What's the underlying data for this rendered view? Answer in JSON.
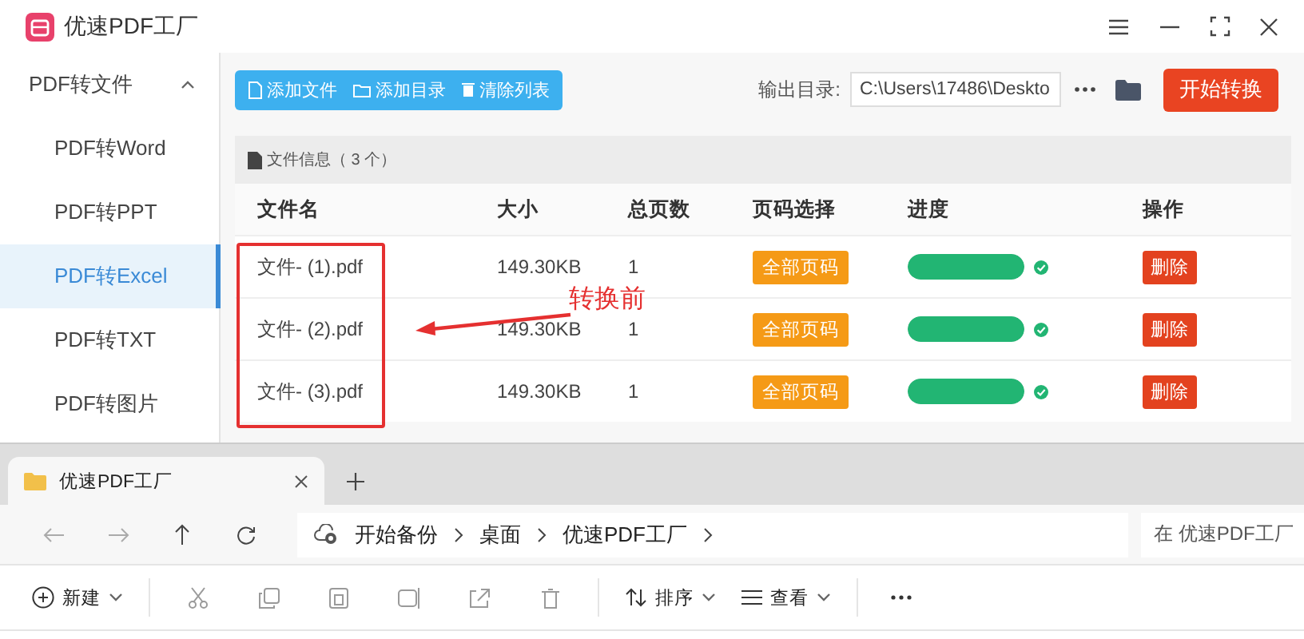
{
  "window": {
    "title": "优速PDF工厂"
  },
  "sidebar": {
    "items": [
      {
        "label": "PDF转文件",
        "kind": "group",
        "expanded": true,
        "selected": false
      },
      {
        "label": "PDF转Word",
        "kind": "item",
        "selected": false
      },
      {
        "label": "PDF转PPT",
        "kind": "item",
        "selected": false
      },
      {
        "label": "PDF转Excel",
        "kind": "item",
        "selected": true
      },
      {
        "label": "PDF转TXT",
        "kind": "item",
        "selected": false
      },
      {
        "label": "PDF转图片",
        "kind": "item",
        "selected": false
      }
    ]
  },
  "toolbar": {
    "buttons": [
      {
        "label": "添加文件",
        "kind": "file"
      },
      {
        "label": "添加目录",
        "kind": "folder"
      },
      {
        "label": "清除列表",
        "kind": "trash"
      }
    ],
    "output_label": "输出目录:",
    "output_path": "C:\\Users\\17486\\Deskto",
    "start_button": "开始转换"
  },
  "file_info": "文件信息（ 3 个）",
  "table": {
    "columns": [
      "文件名",
      "大小",
      "总页数",
      "页码选择",
      "进度",
      "操作"
    ],
    "rows": [
      {
        "name": "文件- (1).pdf",
        "size": "149.30KB",
        "pages": "1",
        "page_select": "全部页码",
        "level": 1,
        "done": true,
        "action": "删除"
      },
      {
        "name": "文件- (2).pdf",
        "size": "149.30KB",
        "pages": "1",
        "page_select": "全部页码",
        "level": 1,
        "done": true,
        "action": "删除"
      },
      {
        "name": "文件- (3).pdf",
        "size": "149.30KB",
        "pages": "1",
        "page_select": "全部页码",
        "level": 1,
        "done": true,
        "action": "删除"
      }
    ]
  },
  "annotation": {
    "label": "转换前"
  },
  "explorer": {
    "tabs": [
      {
        "label": "优速PDF工厂",
        "selected": true
      }
    ],
    "breadcrumb": [
      "开始备份",
      "桌面",
      "优速PDF工厂"
    ],
    "search_placeholder": "在 优速PDF工厂",
    "new_label": "新建",
    "sort_label": "排序",
    "view_label": "查看"
  }
}
